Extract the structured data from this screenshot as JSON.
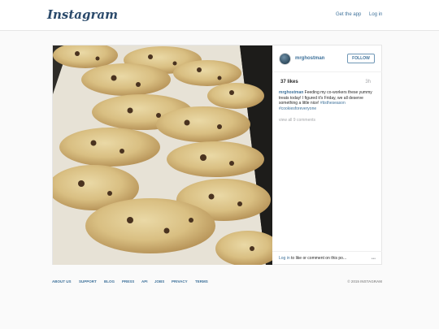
{
  "header": {
    "logo": "Instagram",
    "get_app": "Get the app",
    "login": "Log in"
  },
  "post": {
    "username": "mrghostman",
    "follow_label": "FOLLOW",
    "likes": "37 likes",
    "time": "3h",
    "caption_user": "mrghostman",
    "caption_text": "Feeding my co-workers these yummy treats today! I figured it's Friday, we all deserve something a little nice!",
    "hashtags": [
      "#tistheseason",
      "#cookiesforeveryone"
    ],
    "view_all": "view all 9 comments",
    "login_prompt_link": "Log in",
    "login_prompt_text": "to like or comment on this po...",
    "more": "•••",
    "image_subject": "chocolate chip cookies on baking tray"
  },
  "footer": {
    "links": [
      "ABOUT US",
      "SUPPORT",
      "BLOG",
      "PRESS",
      "API",
      "JOBS",
      "PRIVACY",
      "TERMS"
    ],
    "copyright": "© 2015 INSTAGRAM"
  },
  "colors": {
    "link": "#3f729b",
    "muted": "#a5a7aa",
    "background": "#fafafa"
  }
}
